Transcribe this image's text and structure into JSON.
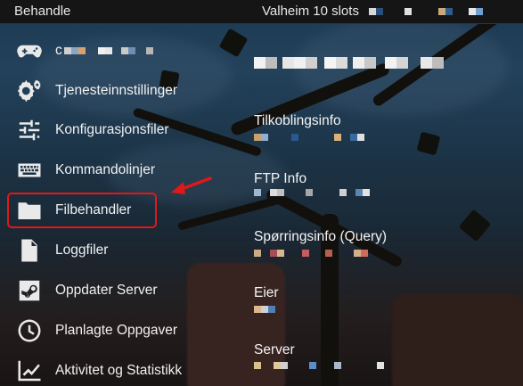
{
  "topbar": {
    "title": "Behandle",
    "server_name": "Valheim 10 slots"
  },
  "menu": [
    {
      "label": "c",
      "icon": "gamepad-icon"
    },
    {
      "label": "Tjenesteinnstillinger",
      "icon": "gears-icon"
    },
    {
      "label": "Konfigurasjonsfiler",
      "icon": "sliders-icon"
    },
    {
      "label": "Kommandolinjer",
      "icon": "keyboard-icon"
    },
    {
      "label": "Filbehandler",
      "icon": "folder-icon"
    },
    {
      "label": "Loggfiler",
      "icon": "log-file-icon"
    },
    {
      "label": "Oppdater Server",
      "icon": "steam-icon"
    },
    {
      "label": "Planlagte Oppgaver",
      "icon": "clock-icon"
    },
    {
      "label": "Aktivitet og Statistikk",
      "icon": "chart-line-icon"
    }
  ],
  "info": {
    "connection": "Tilkoblingsinfo",
    "ftp": "FTP Info",
    "query": "Spørringsinfo (Query)",
    "owner": "Eier",
    "server": "Server"
  },
  "colors": {
    "highlight": "#e01818",
    "topbar_bg": "#151515"
  }
}
